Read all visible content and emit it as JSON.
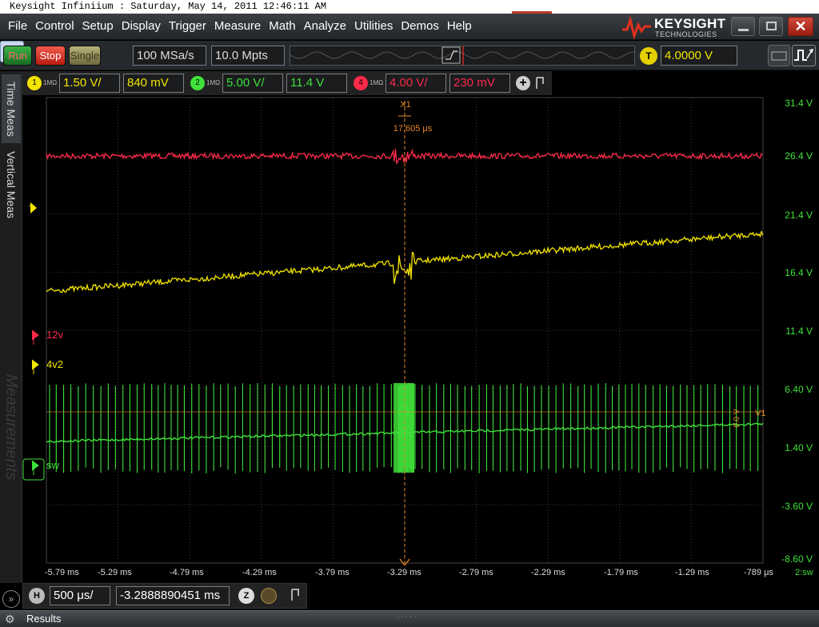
{
  "os_title": "Keysight Infiniium : Saturday, May 14, 2011 12:46:11 AM",
  "menu": [
    "File",
    "Control",
    "Setup",
    "Display",
    "Trigger",
    "Measure",
    "Math",
    "Analyze",
    "Utilities",
    "Demos",
    "Help"
  ],
  "brand": {
    "name": "KEYSIGHT",
    "sub": "TECHNOLOGIES"
  },
  "window_controls": {
    "close_glyph": "✕"
  },
  "toolbar": {
    "run_label": "Run",
    "stop_label": "Stop",
    "single_label": "Single",
    "sample_rate": "100 MSa/s",
    "memory_depth": "10.0 Mpts",
    "trigger_indicator": "T",
    "trigger_level": "4.0000 V"
  },
  "channels": [
    {
      "id": "1",
      "impedance": "1MΩ",
      "scale": "1.50 V/",
      "offset": "840 mV",
      "color": "#f3e500"
    },
    {
      "id": "2",
      "impedance": "1MΩ",
      "scale": "5.00 V/",
      "offset": "11.4 V",
      "color": "#3fe23a"
    },
    {
      "id": "4",
      "impedance": "1MΩ",
      "scale": "4.00 V/",
      "offset": "230 mV",
      "color": "#ff2a4a"
    }
  ],
  "side_tabs": {
    "time_meas": "Time Meas",
    "vertical_meas": "Vertical Meas",
    "measurements": "Measurements",
    "expand_glyph": "»"
  },
  "plot": {
    "y_labels": [
      "31.4 V",
      "26.4 V",
      "21.4 V",
      "16.4 V",
      "11.4 V",
      "6.40 V",
      "1.40 V",
      "-3.60 V",
      "-8.60 V"
    ],
    "x_labels": [
      "-5.79 ms",
      "-5.29 ms",
      "-4.79 ms",
      "-4.29 ms",
      "-3.79 ms",
      "-3.29 ms",
      "-2.79 ms",
      "-2.29 ms",
      "-1.79 ms",
      "-1.29 ms",
      "-789 μs"
    ],
    "x_unit_label": "2:sw",
    "markers": {
      "red_label": "12v",
      "yellow_label": "4v2",
      "green_label": "sw",
      "trigger_marker": "T",
      "cursor_label": "X1",
      "cursor_delta": "17.605 μs",
      "v1_label": "V1",
      "v1_value": "0.0 V"
    },
    "colors": {
      "red": "#ff2a4a",
      "yellow": "#f3e500",
      "green": "#3fe23a",
      "cursor": "#e88a2a"
    }
  },
  "horizontal": {
    "indicator": "H",
    "scale": "500 μs/",
    "position": "-3.2888890451 ms",
    "zoom_glyph": "Z"
  },
  "results": {
    "label": "Results"
  }
}
